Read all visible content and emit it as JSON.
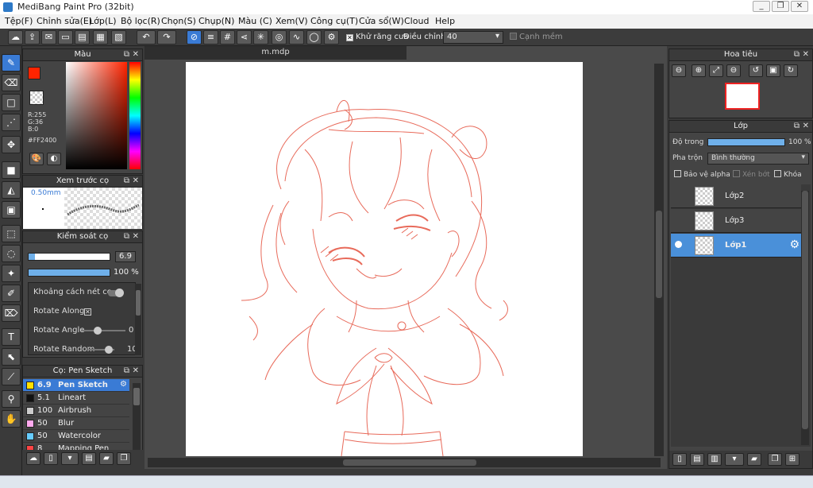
{
  "window": {
    "title": "MediBang Paint Pro (32bit)",
    "minimize_icon": "minimize-icon",
    "restore_icon": "restore-icon",
    "close_icon": "close-icon"
  },
  "menu": [
    "Tệp(F)",
    "Chỉnh sửa(E)",
    "Lớp(L)",
    "Bộ lọc(R)",
    "Chọn(S)",
    "Chụp(N)",
    "Màu (C)",
    "Xem(V)",
    "Công cụ(T)",
    "Cửa sổ(W)",
    "Cloud",
    "Help"
  ],
  "toolbar": {
    "antialias_label": "Khử răng cưa",
    "antialias_checked": true,
    "correction_label": "Điều chỉnh",
    "correction_value": "40",
    "soft_edge_label": "Cạnh mềm",
    "soft_edge_checked": false
  },
  "color_panel": {
    "title": "Màu",
    "fg_color": "#FF2400",
    "r": "R:255",
    "g": "G:36",
    "b": "B:0",
    "hex": "#FF2400"
  },
  "preview_panel": {
    "title": "Xem trước cọ",
    "size": "0.50mm"
  },
  "control_panel": {
    "title": "Kiểm soát cọ",
    "size_value": "6.9",
    "size_fraction": 0.08,
    "opacity_value": "100 %",
    "opacity_fraction": 1.0,
    "rows": [
      {
        "label": "Khoảng cách nét cọ"
      },
      {
        "label": "Rotate Along"
      },
      {
        "label": "Rotate Angle",
        "value": "0"
      },
      {
        "label": "Rotate Random",
        "value": "10"
      }
    ]
  },
  "brush_panel": {
    "title": "Cọ: Pen Sketch",
    "brushes": [
      {
        "size": "6.9",
        "name": "Pen Sketch",
        "color": "#ffe000",
        "selected": true
      },
      {
        "size": "5.1",
        "name": "Lineart",
        "color": "#111111"
      },
      {
        "size": "100",
        "name": "Airbrush",
        "color": "#cccccc"
      },
      {
        "size": "50",
        "name": "Blur",
        "color": "#ffaaee"
      },
      {
        "size": "50",
        "name": "Watercolor",
        "color": "#66ccff"
      },
      {
        "size": "8",
        "name": "Mapping Pen",
        "color": "#ff4444"
      }
    ]
  },
  "document": {
    "tab": "m.mdp",
    "stroke_color": "#e86a5a"
  },
  "navigator": {
    "title": "Hoa tiêu"
  },
  "layers": {
    "title": "Lớp",
    "opacity_label": "Độ trong",
    "opacity_value": "100 %",
    "opacity_fraction": 1.0,
    "blend_label": "Pha trộn",
    "blend_value": "Bình thường",
    "protect_alpha": "Bảo vệ alpha",
    "clipping": "Xén bớt",
    "lock": "Khóa",
    "items": [
      {
        "name": "Lớp2",
        "selected": false
      },
      {
        "name": "Lớp3",
        "selected": false
      },
      {
        "name": "Lớp1",
        "selected": true
      }
    ]
  },
  "accent": "#3a7bd5"
}
